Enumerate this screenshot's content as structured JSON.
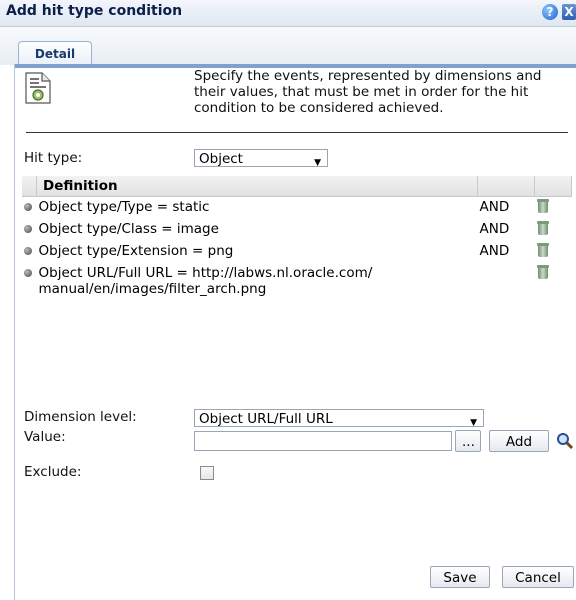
{
  "window": {
    "title": "Add hit type condition",
    "help_glyph": "?",
    "close_glyph": "X"
  },
  "tabs": [
    {
      "label": "Detail",
      "active": true
    }
  ],
  "description": "Specify the events, represented by dimensions and their values, that must be met in order for the hit condition to be considered achieved.",
  "hit_type": {
    "label": "Hit type:",
    "value": "Object"
  },
  "definition_table": {
    "header": "Definition",
    "rows": [
      {
        "text": "Object type/Type = static",
        "operator": "AND"
      },
      {
        "text": "Object type/Class = image",
        "operator": "AND"
      },
      {
        "text": "Object type/Extension = png",
        "operator": "AND"
      },
      {
        "text": "Object URL/Full URL = http://labws.nl.oracle.com/ manual/en/images/filter_arch.png",
        "operator": ""
      }
    ]
  },
  "dimension_level": {
    "label": "Dimension level:",
    "value": "Object URL/Full URL"
  },
  "value_field": {
    "label": "Value:",
    "value": "",
    "browse_label": "...",
    "add_label": "Add"
  },
  "exclude": {
    "label": "Exclude:",
    "checked": false
  },
  "footer": {
    "save_label": "Save",
    "cancel_label": "Cancel"
  },
  "colors": {
    "tab_border": "#7fa1cf",
    "title_text": "#0b1f4a",
    "icon_blue": "#1a63c9"
  }
}
